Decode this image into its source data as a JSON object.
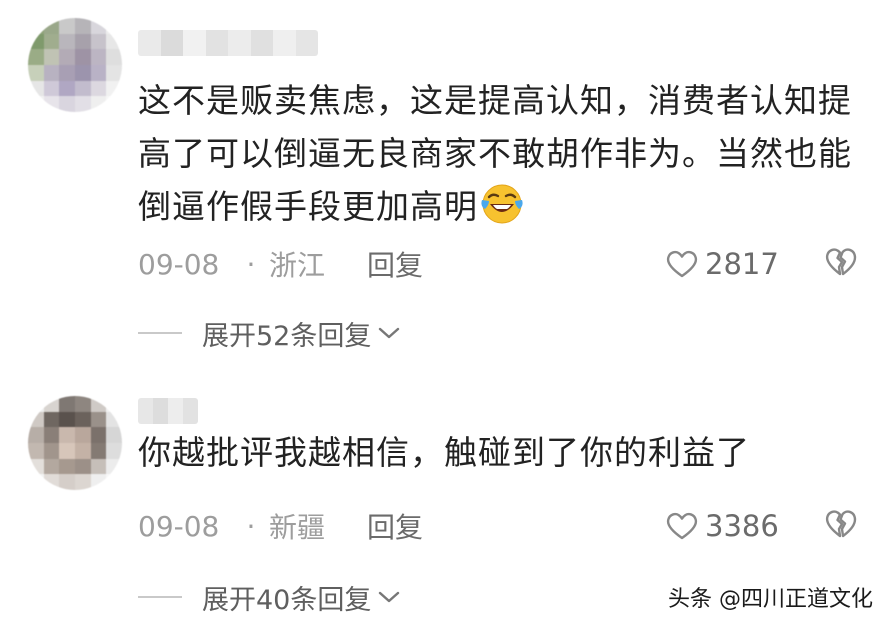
{
  "comments": [
    {
      "text_line1": "这不是贩卖焦虑，这是提高认知，消费者认知提",
      "text_line2": "高了可以倒逼无良商家不敢胡作非为。当然也能",
      "text_line3": "倒逼作假手段更加高明",
      "emoji": "laughing-tears-emoji",
      "date": "09-08",
      "region": "浙江",
      "reply_label": "回复",
      "likes": "2817",
      "expand_label": "展开52条回复"
    },
    {
      "text_line1": "你越批评我越相信，触碰到了你的利益了",
      "date": "09-08",
      "region": "新疆",
      "reply_label": "回复",
      "likes": "3386",
      "expand_label": "展开40条回复"
    }
  ],
  "separator": "·",
  "watermark": "头条 @四川正道文化",
  "icons": {
    "like": "heart-outline-icon",
    "dislike": "broken-heart-icon",
    "expand": "chevron-down-icon"
  },
  "colors": {
    "text": "#222222",
    "meta": "#9d9d9d",
    "action": "#6b6b6b"
  }
}
